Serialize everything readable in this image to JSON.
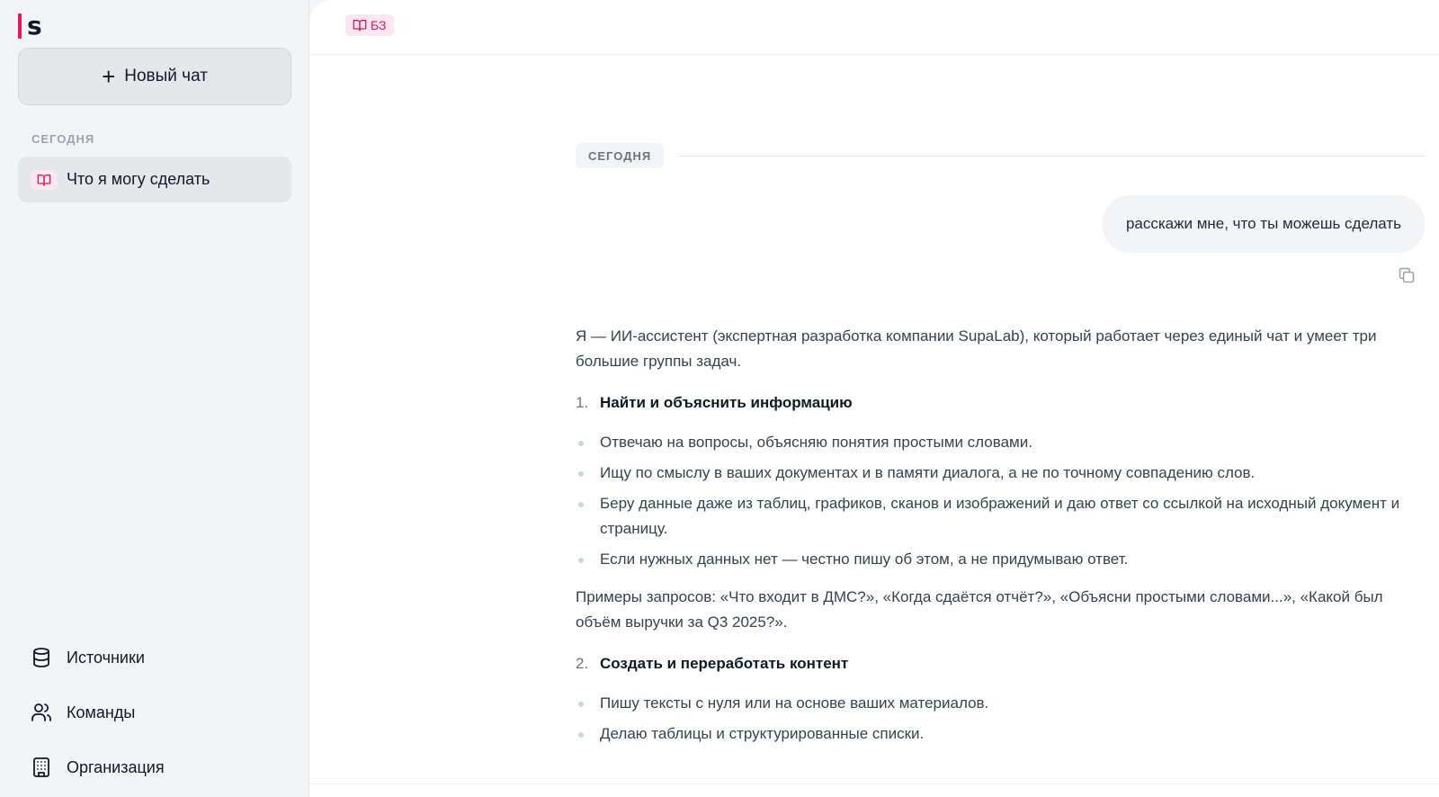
{
  "app": {
    "logo_text": "s",
    "brand_color": "#e8175d"
  },
  "sidebar": {
    "new_chat_label": "Новый чат",
    "section_today": "СЕГОДНЯ",
    "chats": [
      {
        "label": "Что я могу сделать",
        "icon": "book-icon"
      }
    ],
    "nav": [
      {
        "label": "Источники",
        "icon": "database-icon"
      },
      {
        "label": "Команды",
        "icon": "users-icon"
      },
      {
        "label": "Организация",
        "icon": "building-icon"
      }
    ]
  },
  "topbar": {
    "kb_tag": "БЗ"
  },
  "conversation": {
    "date_label": "СЕГОДНЯ",
    "user_message": "расскажи мне, что ты можешь сделать",
    "answer": {
      "intro": "Я — ИИ-ассистент (экспертная разработка компании SupaLab), который работает через единый чат и умеет три большие группы задач.",
      "section1": {
        "num": "1.",
        "title": "Найти и объяснить информацию"
      },
      "section1_items": [
        "Отвечаю на вопросы, объясняю понятия простыми словами.",
        "Ищу по смыслу в ваших документах и в памяти диалога, а не по точному совпадению слов.",
        "Беру данные даже из таблиц, графиков, сканов и изображений и даю ответ со ссылкой на исходный документ и страницу.",
        "Если нужных данных нет — честно пишу об этом, а не придумываю ответ."
      ],
      "examples": "Примеры запросов: «Что входит в ДМС?», «Когда сдаётся отчёт?», «Объясни простыми словами...», «Какой был объём выручки за Q3 2025?».",
      "section2": {
        "num": "2.",
        "title": "Создать и переработать контент"
      },
      "section2_items": [
        "Пишу тексты с нуля или на основе ваших материалов.",
        "Делаю таблицы и структурированные списки."
      ]
    }
  }
}
